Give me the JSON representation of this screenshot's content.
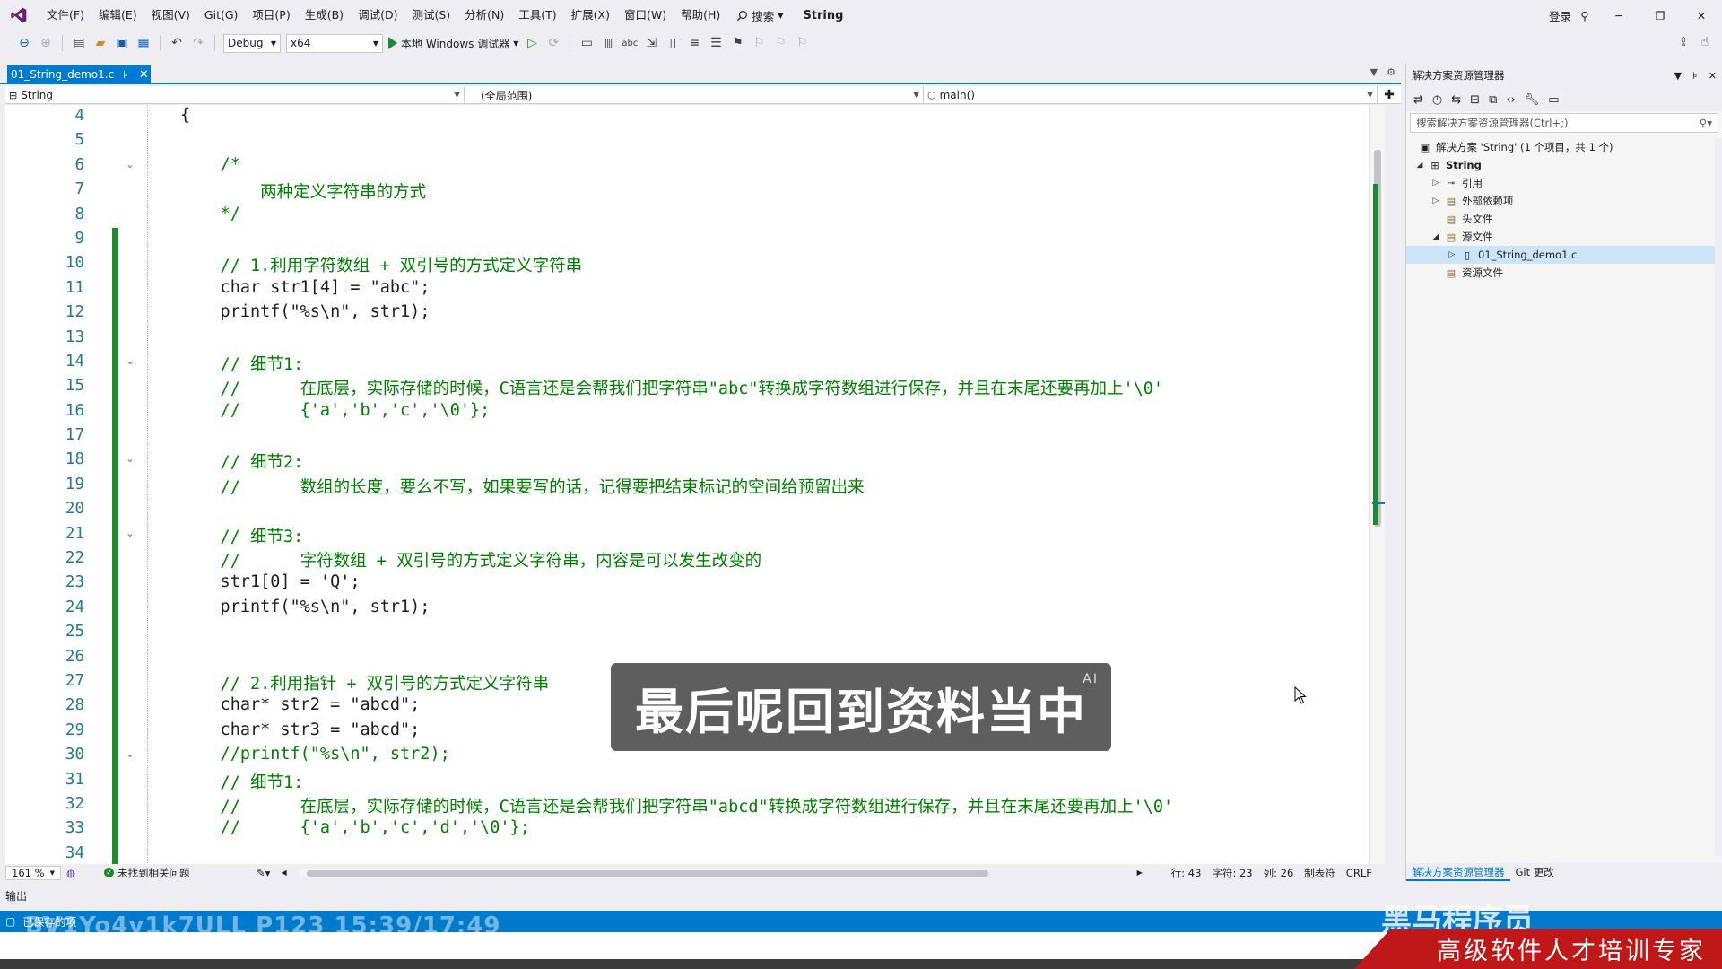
{
  "menubar": {
    "items": [
      "文件(F)",
      "编辑(E)",
      "视图(V)",
      "Git(G)",
      "项目(P)",
      "生成(B)",
      "调试(D)",
      "测试(S)",
      "分析(N)",
      "工具(T)",
      "扩展(X)",
      "窗口(W)",
      "帮助(H)"
    ],
    "search_label": "搜索",
    "solution_title": "String",
    "login_label": "登录"
  },
  "toolbar": {
    "config": "Debug",
    "platform": "x64",
    "run_label": "本地 Windows 调试器"
  },
  "editor_tab": {
    "filename": "01_String_demo1.c"
  },
  "navbar": {
    "project": "String",
    "scope": "(全局范围)",
    "member": "main()"
  },
  "code": {
    "lines": [
      {
        "n": "4",
        "t": "{",
        "c": false,
        "fold": false,
        "chg": false
      },
      {
        "n": "5",
        "t": "",
        "c": false,
        "fold": false,
        "chg": false
      },
      {
        "n": "6",
        "t": "    /*",
        "c": true,
        "fold": true,
        "chg": false
      },
      {
        "n": "7",
        "t": "        两种定义字符串的方式",
        "c": true,
        "fold": false,
        "chg": false
      },
      {
        "n": "8",
        "t": "    */",
        "c": true,
        "fold": false,
        "chg": false
      },
      {
        "n": "9",
        "t": "",
        "c": false,
        "fold": false,
        "chg": true
      },
      {
        "n": "10",
        "t": "    // 1.利用字符数组 + 双引号的方式定义字符串",
        "c": true,
        "fold": false,
        "chg": true
      },
      {
        "n": "11",
        "t": "    char str1[4] = \"abc\";",
        "c": false,
        "fold": false,
        "chg": true
      },
      {
        "n": "12",
        "t": "    printf(\"%s\\n\", str1);",
        "c": false,
        "fold": false,
        "chg": true
      },
      {
        "n": "13",
        "t": "",
        "c": false,
        "fold": false,
        "chg": true
      },
      {
        "n": "14",
        "t": "    // 细节1:",
        "c": true,
        "fold": true,
        "chg": true
      },
      {
        "n": "15",
        "t": "    //      在底层，实际存储的时候，C语言还是会帮我们把字符串\"abc\"转换成字符数组进行保存，并且在末尾还要再加上'\\0'",
        "c": true,
        "fold": false,
        "chg": true
      },
      {
        "n": "16",
        "t": "    //      {'a','b','c','\\0'};",
        "c": true,
        "fold": false,
        "chg": true
      },
      {
        "n": "17",
        "t": "",
        "c": false,
        "fold": false,
        "chg": true
      },
      {
        "n": "18",
        "t": "    // 细节2:",
        "c": true,
        "fold": true,
        "chg": true
      },
      {
        "n": "19",
        "t": "    //      数组的长度，要么不写，如果要写的话，记得要把结束标记的空间给预留出来",
        "c": true,
        "fold": false,
        "chg": true
      },
      {
        "n": "20",
        "t": "",
        "c": false,
        "fold": false,
        "chg": true
      },
      {
        "n": "21",
        "t": "    // 细节3:",
        "c": true,
        "fold": true,
        "chg": true
      },
      {
        "n": "22",
        "t": "    //      字符数组 + 双引号的方式定义字符串，内容是可以发生改变的",
        "c": true,
        "fold": false,
        "chg": true
      },
      {
        "n": "23",
        "t": "    str1[0] = 'Q';",
        "c": false,
        "fold": false,
        "chg": true
      },
      {
        "n": "24",
        "t": "    printf(\"%s\\n\", str1);",
        "c": false,
        "fold": false,
        "chg": true
      },
      {
        "n": "25",
        "t": "",
        "c": false,
        "fold": false,
        "chg": true
      },
      {
        "n": "26",
        "t": "",
        "c": false,
        "fold": false,
        "chg": true
      },
      {
        "n": "27",
        "t": "    // 2.利用指针 + 双引号的方式定义字符串",
        "c": true,
        "fold": false,
        "chg": true
      },
      {
        "n": "28",
        "t": "    char* str2 = \"abcd\";",
        "c": false,
        "fold": false,
        "chg": true
      },
      {
        "n": "29",
        "t": "    char* str3 = \"abcd\";",
        "c": false,
        "fold": false,
        "chg": true
      },
      {
        "n": "30",
        "t": "    //printf(\"%s\\n\", str2);",
        "c": true,
        "fold": true,
        "chg": true
      },
      {
        "n": "31",
        "t": "    // 细节1:",
        "c": true,
        "fold": false,
        "chg": true
      },
      {
        "n": "32",
        "t": "    //      在底层，实际存储的时候，C语言还是会帮我们把字符串\"abcd\"转换成字符数组进行保存，并且在末尾还要再加上'\\0'",
        "c": true,
        "fold": false,
        "chg": true
      },
      {
        "n": "33",
        "t": "    //      {'a','b','c','d','\\0'};",
        "c": true,
        "fold": false,
        "chg": true
      },
      {
        "n": "34",
        "t": "",
        "c": false,
        "fold": false,
        "chg": true
      }
    ]
  },
  "caption": {
    "text": "最后呢回到资料当中",
    "ai_badge": "AI"
  },
  "editor_status": {
    "zoom": "161 %",
    "issues": "未找到相关问题",
    "line": "行: 43",
    "char": "字符: 23",
    "col": "列: 26",
    "indent": "制表符",
    "eol": "CRLF"
  },
  "output": {
    "label": "输出"
  },
  "statusbar": {
    "text": "已保存的项"
  },
  "watermark": {
    "video_id": "BV1Yo4y1k7ULL P123 15:39/17:49",
    "brand": "黑马程序员",
    "slogan": "高级软件人才培训专家"
  },
  "solution_explorer": {
    "title": "解决方案资源管理器",
    "search_placeholder": "搜索解决方案资源管理器(Ctrl+;)",
    "solution": "解决方案 'String' (1 个项目，共 1 个)",
    "project": "String",
    "nodes": [
      "引用",
      "外部依赖项",
      "头文件",
      "源文件",
      "01_String_demo1.c",
      "资源文件"
    ],
    "tabs": [
      "解决方案资源管理器",
      "Git 更改"
    ]
  },
  "colors": {
    "accent": "#007acc",
    "comment": "#008000",
    "change_bar": "#1e8a2e",
    "line_number": "#237893",
    "brand_red": "#c01818"
  }
}
